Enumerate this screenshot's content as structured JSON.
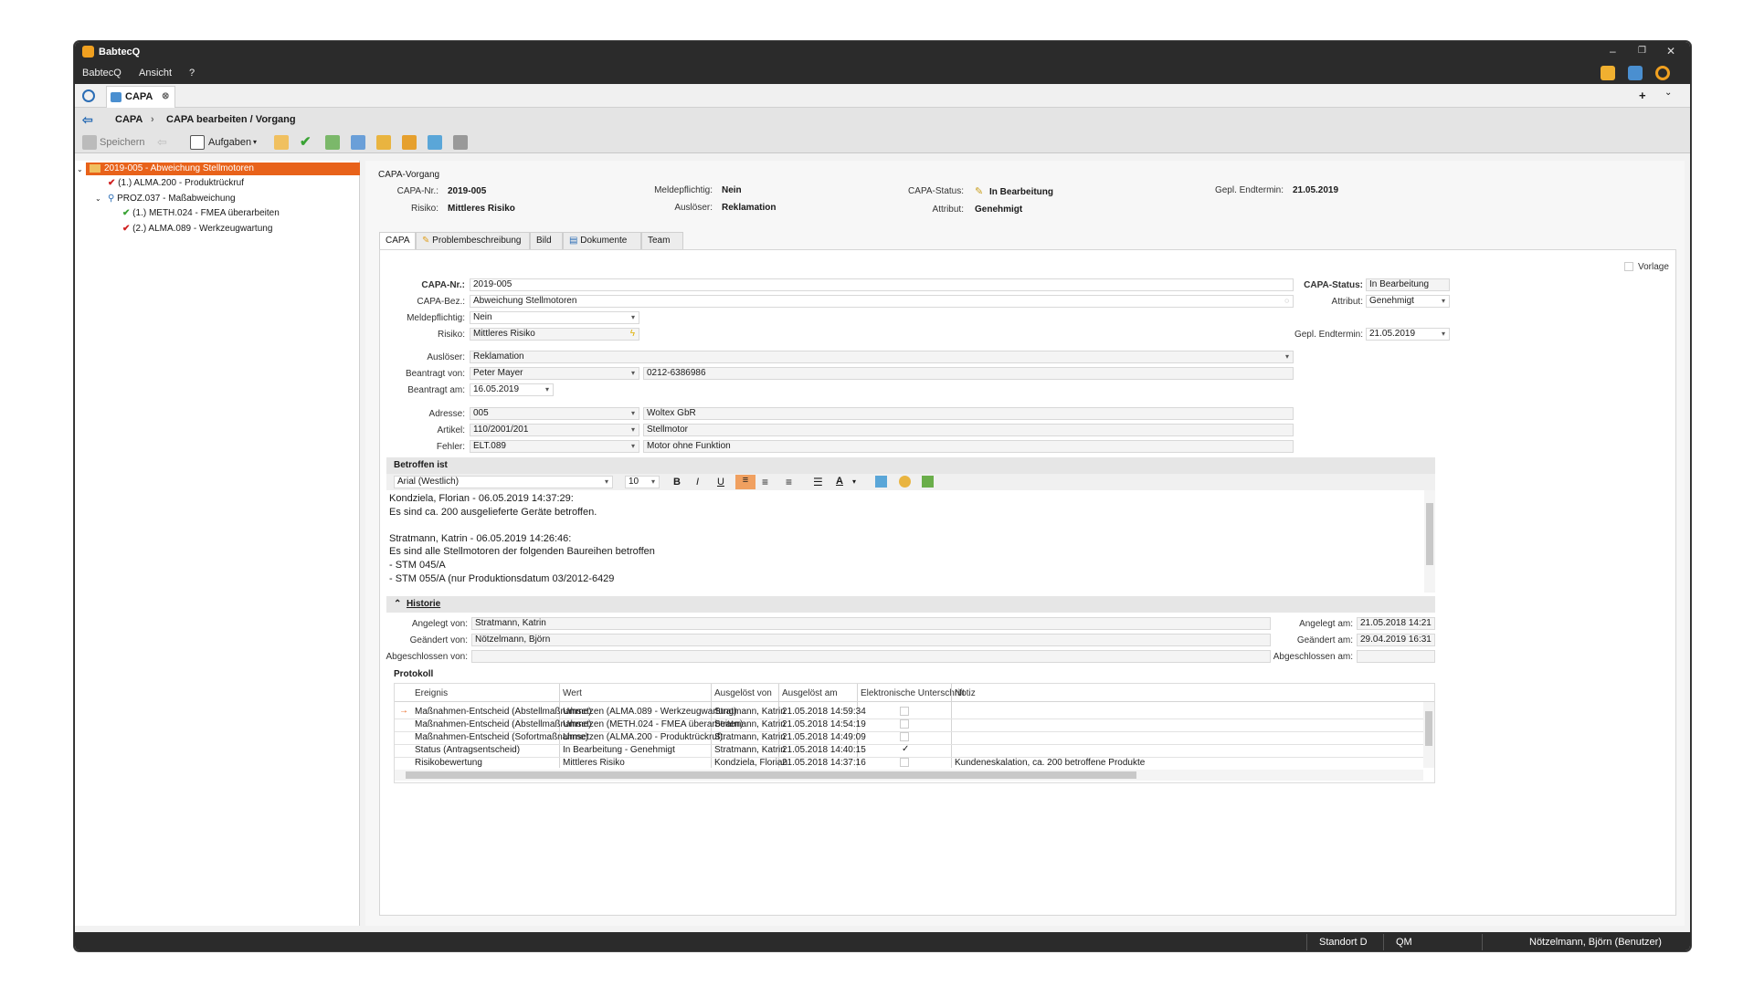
{
  "app": {
    "title": "BabtecQ"
  },
  "menu": {
    "items": [
      "BabtecQ",
      "Ansicht",
      "?"
    ]
  },
  "doc_tab": {
    "label": "CAPA"
  },
  "breadcrumb": {
    "root": "CAPA",
    "current": "CAPA bearbeiten / Vorgang"
  },
  "toolbar": {
    "save": "Speichern",
    "tasks": "Aufgaben"
  },
  "tree": [
    "2019-005 - Abweichung Stellmotoren",
    "(1.) ALMA.200 - Produktrückruf",
    "PROZ.037 - Maßabweichung",
    "(1.) METH.024 - FMEA überarbeiten",
    "(2.) ALMA.089 - Werkzeugwartung"
  ],
  "header": {
    "title": "CAPA-Vorgang",
    "capa_nr_label": "CAPA-Nr.:",
    "capa_nr": "2019-005",
    "risk_label": "Risiko:",
    "risk": "Mittleres Risiko",
    "report_label": "Meldepflichtig:",
    "report": "Nein",
    "trigger_label": "Auslöser:",
    "trigger": "Reklamation",
    "status_label": "CAPA-Status:",
    "status": "In Bearbeitung",
    "attr_label": "Attribut:",
    "attr": "Genehmigt",
    "enddate_label": "Gepl. Endtermin:",
    "enddate": "21.05.2019"
  },
  "tabs": [
    "CAPA",
    "Problembeschreibung",
    "Bild",
    "Dokumente",
    "Team"
  ],
  "form": {
    "template": "Vorlage",
    "capa_nr_label": "CAPA-Nr.:",
    "capa_nr": "2019-005",
    "capa_bez_label": "CAPA-Bez.:",
    "capa_bez": "Abweichung Stellmotoren",
    "report_label": "Meldepflichtig:",
    "report": "Nein",
    "risk_label": "Risiko:",
    "risk": "Mittleres Risiko",
    "trigger_label": "Auslöser:",
    "trigger": "Reklamation",
    "requested_by_label": "Beantragt von:",
    "requested_by": "Peter Mayer",
    "phone": "0212-6386986",
    "requested_on_label": "Beantragt am:",
    "requested_on": "16.05.2019",
    "address_label": "Adresse:",
    "address": "005",
    "address_name": "Woltex GbR",
    "article_label": "Artikel:",
    "article": "110/2001/201",
    "article_name": "Stellmotor",
    "error_label": "Fehler:",
    "error": "ELT.089",
    "error_name": "Motor ohne Funktion",
    "status_label": "CAPA-Status:",
    "status": "In Bearbeitung",
    "attr_label": "Attribut:",
    "attr": "Genehmigt",
    "enddate_label": "Gepl. Endtermin:",
    "enddate": "21.05.2019"
  },
  "affected": {
    "title": "Betroffen ist",
    "font": "Arial (Westlich)",
    "size": "10",
    "text": "Kondziela, Florian - 06.05.2019 14:37:29:\nEs sind ca. 200 ausgelieferte Geräte betroffen.\n\nStratmann, Katrin - 06.05.2019 14:26:46:\nEs sind alle Stellmotoren der folgenden Baureihen betroffen\n- STM 045/A\n- STM 055/A (nur Produktionsdatum 03/2012-6429"
  },
  "history": {
    "title": "Historie",
    "created_by_label": "Angelegt von:",
    "created_by": "Stratmann, Katrin",
    "changed_by_label": "Geändert von:",
    "changed_by": "Nötzelmann, Björn",
    "closed_by_label": "Abgeschlossen von:",
    "closed_by": "",
    "created_on_label": "Angelegt am:",
    "created_on": "21.05.2018 14:21",
    "changed_on_label": "Geändert am:",
    "changed_on": "29.04.2019 16:31",
    "closed_on_label": "Abgeschlossen am:",
    "closed_on": ""
  },
  "protocol": {
    "title": "Protokoll",
    "columns": [
      "Ereignis",
      "Wert",
      "Ausgelöst von",
      "Ausgelöst am",
      "Elektronische Unterschrift",
      "Notiz"
    ],
    "rows": [
      [
        "Maßnahmen-Entscheid (Abstellmaßnahme)",
        "Umsetzen (ALMA.089 - Werkzeugwartung)",
        "Stratmann, Katrin",
        "21.05.2018 14:59:34",
        "",
        ""
      ],
      [
        "Maßnahmen-Entscheid (Abstellmaßnahme)",
        "Umsetzen (METH.024 - FMEA überarbeiten)",
        "Stratmann, Katrin",
        "21.05.2018 14:54:19",
        "",
        ""
      ],
      [
        "Maßnahmen-Entscheid (Sofortmaßnahme)",
        "Umsetzen (ALMA.200 - Produktrückruf)",
        "Stratmann, Katrin",
        "21.05.2018 14:49:09",
        "",
        ""
      ],
      [
        "Status (Antragsentscheid)",
        "In Bearbeitung - Genehmigt",
        "Stratmann, Katrin",
        "21.05.2018 14:40:15",
        "✓",
        ""
      ],
      [
        "Risikobewertung",
        "Mittleres Risiko",
        "Kondziela, Florian",
        "21.05.2018 14:37:16",
        "",
        "Kundeneskalation, ca. 200 betroffene Produkte"
      ]
    ]
  },
  "status": {
    "location": "Standort D",
    "module": "QM",
    "user": "Nötzelmann, Björn (Benutzer)"
  },
  "colors": {
    "accent": "#e8621a",
    "titlebar": "#2b2b2b",
    "check": "#3aa335"
  }
}
